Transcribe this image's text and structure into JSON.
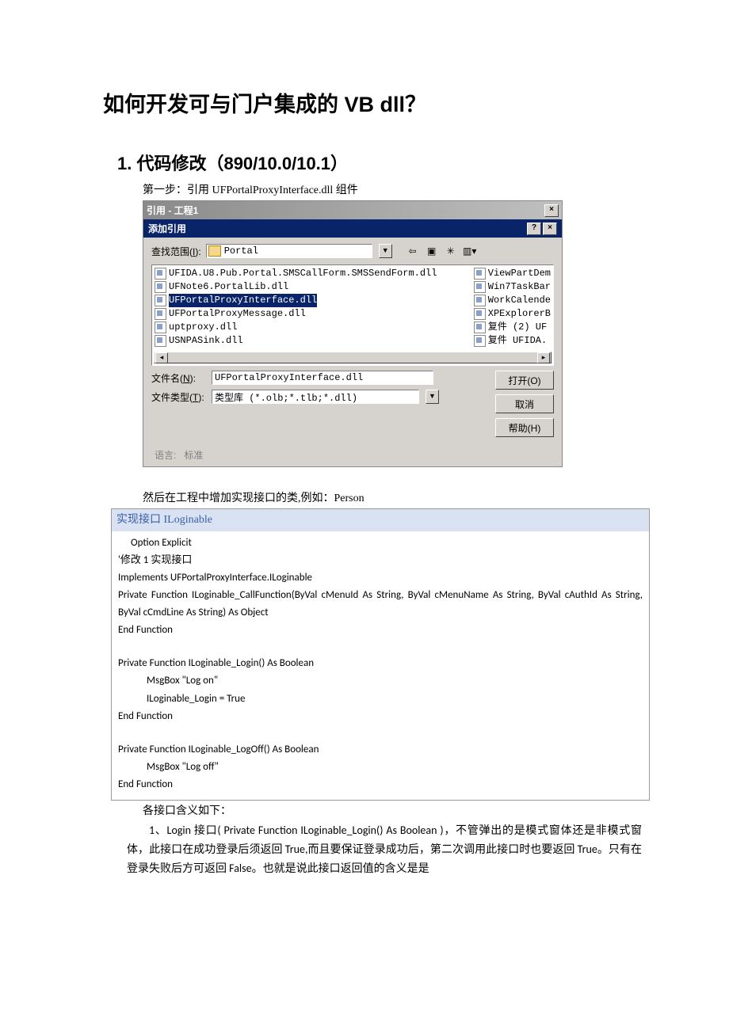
{
  "title": "如何开发可与门户集成的 VB dll？",
  "section1": {
    "heading": "1.  代码修改（890/10.0/10.1）",
    "step1": "第一步：引用 UFPortalProxyInterface.dll 组件"
  },
  "dialog": {
    "title": "引用 - 工程1",
    "subtitle": "添加引用",
    "lookin_label_pre": "查找范围(",
    "lookin_label_acc": "I",
    "lookin_label_post": "):",
    "folder": "Portal",
    "files_left": [
      "UFIDA.U8.Pub.Portal.SMSCallForm.SMSSendForm.dll",
      "UFNote6.PortalLib.dll",
      "UFPortalProxyInterface.dll",
      "UFPortalProxyMessage.dll",
      "uptproxy.dll",
      "USNPASink.dll"
    ],
    "selected_index": 2,
    "files_right": [
      "ViewPartDem",
      "Win7TaskBar",
      "WorkCalende",
      "XPExplorerB",
      "复件 (2) UF",
      "复件 UFIDA."
    ],
    "filename_label_pre": "文件名(",
    "filename_label_acc": "N",
    "filename_label_post": "):",
    "filename_value": "UFPortalProxyInterface.dll",
    "filetype_label_pre": "文件类型(",
    "filetype_label_acc": "T",
    "filetype_label_post": "):",
    "filetype_value": "类型库 (*.olb;*.tlb;*.dll)",
    "btn_open": "打开(O)",
    "btn_cancel": "取消",
    "btn_help": "帮助(H)",
    "status_lang": "语言:",
    "status_std": "标准"
  },
  "after_step": "然后在工程中增加实现接口的类,例如：Person",
  "code": {
    "header": "实现接口 ILoginable",
    "l1": "Option Explicit",
    "l2": "'修改 1 实现接口",
    "l3": "Implements UFPortalProxyInterface.ILoginable",
    "l4": "Private Function ILoginable_CallFunction(ByVal cMenuId As String, ByVal cMenuName As String, ByVal cAuthId As String, ByVal cCmdLine As String) As Object",
    "l5": "End Function",
    "l6": "Private Function ILoginable_Login() As Boolean",
    "l7": "MsgBox \"Log on\"",
    "l8": "ILoginable_Login = True",
    "l9": "End Function",
    "l10": "Private Function ILoginable_LogOff() As Boolean",
    "l11": "MsgBox \"Log off\"",
    "l12": "End Function"
  },
  "after_code": "各接口含义如下：",
  "para1": "1、Login 接口( Private Function ILoginable_Login() As Boolean )，不管弹出的是模式窗体还是非模式窗体，此接口在成功登录后须返回 True,而且要保证登录成功后，第二次调用此接口时也要返回 True。只有在登录失败后方可返回 False。也就是说此接口返回值的含义是是"
}
